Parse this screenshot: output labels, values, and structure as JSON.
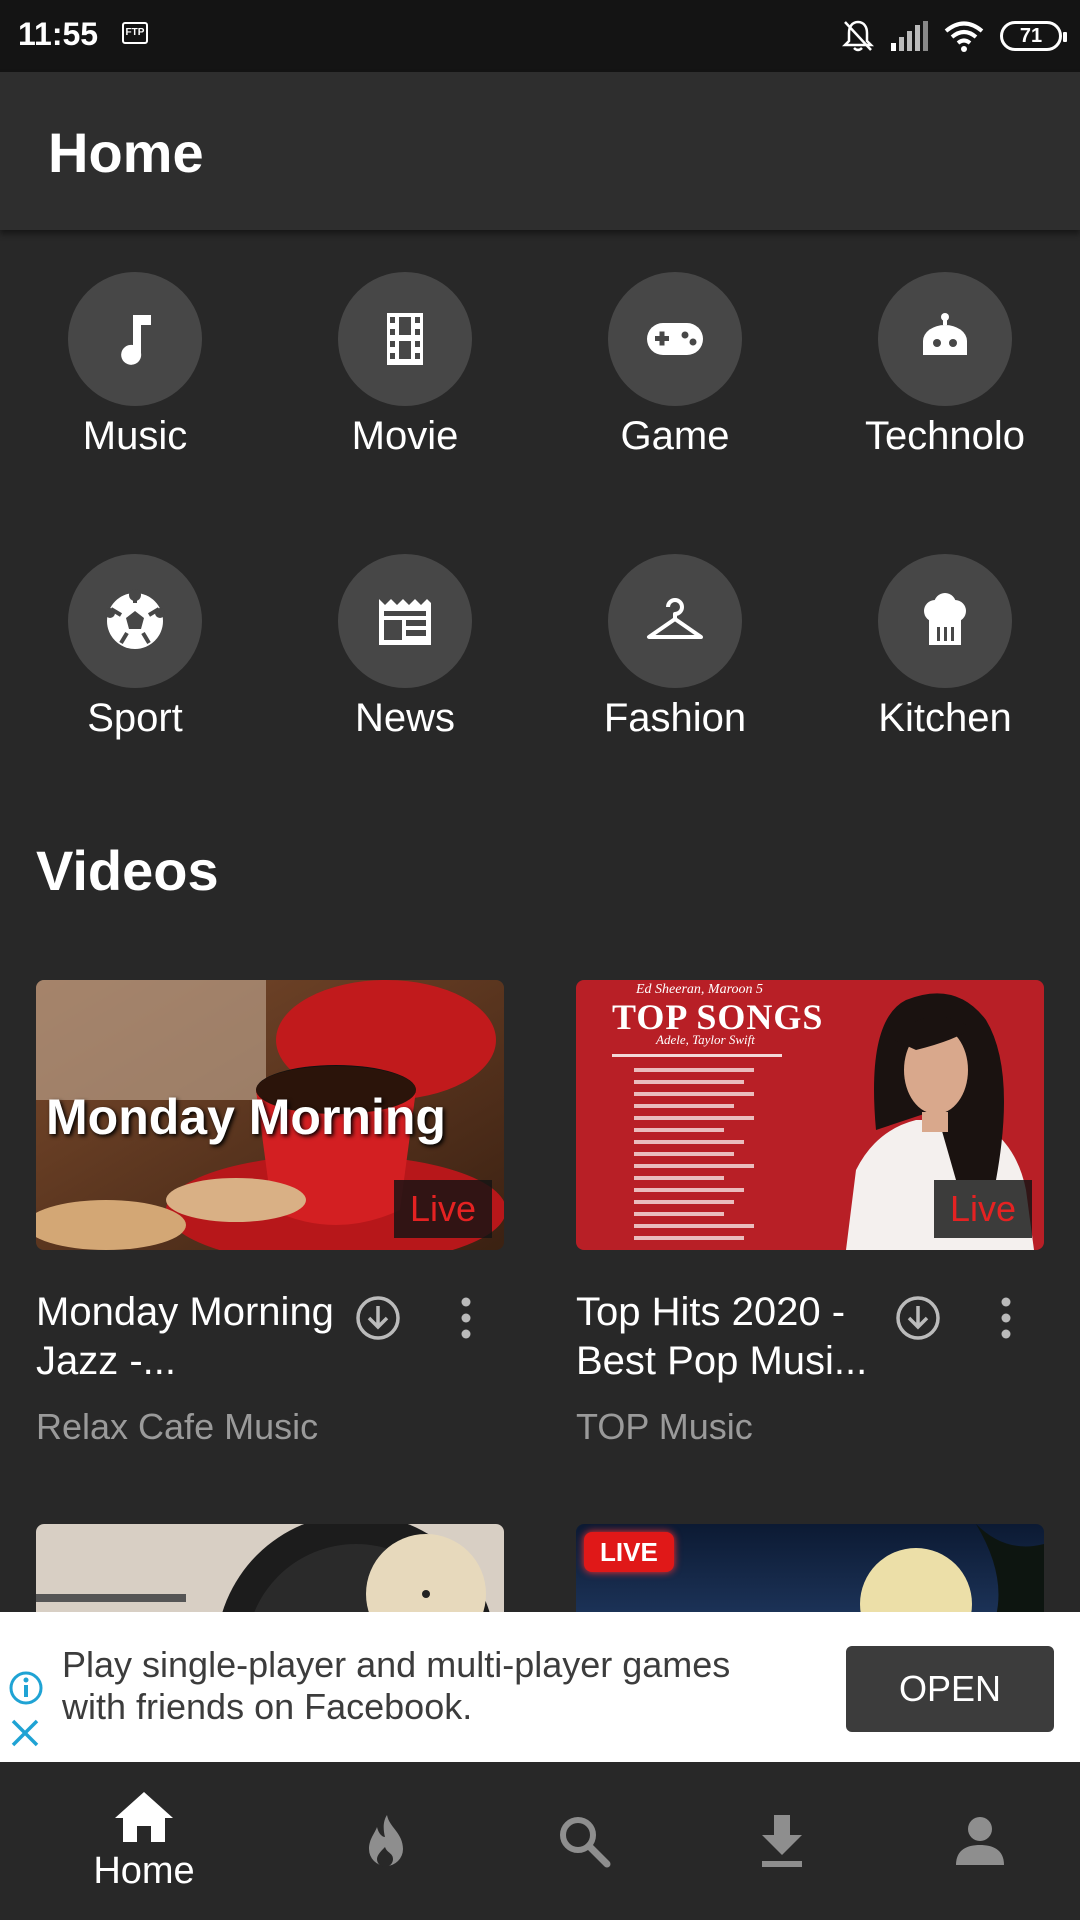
{
  "status_bar": {
    "time": "11:55",
    "ftp_badge": "FTP",
    "battery": "71",
    "icons": [
      "mute-bell-icon",
      "signal-icon",
      "wifi-icon",
      "battery-icon"
    ]
  },
  "app_bar": {
    "title": "Home"
  },
  "categories": [
    {
      "label": "Music",
      "icon": "music-note-icon"
    },
    {
      "label": "Movie",
      "icon": "film-icon"
    },
    {
      "label": "Game",
      "icon": "gamepad-icon"
    },
    {
      "label": "Technolo",
      "icon": "robot-icon"
    },
    {
      "label": "Sport",
      "icon": "soccer-ball-icon"
    },
    {
      "label": "News",
      "icon": "newspaper-icon"
    },
    {
      "label": "Fashion",
      "icon": "hanger-icon"
    },
    {
      "label": "Kitchen",
      "icon": "chef-hat-icon"
    }
  ],
  "videos_section": {
    "title": "Videos"
  },
  "videos": [
    {
      "thumb_text": "Monday Morning",
      "live_badge": "Live",
      "title": "Monday Morning Jazz -...",
      "channel": "Relax Cafe Music"
    },
    {
      "thumb_text": "TOP SONGS",
      "thumb_subtext": "Ed Sheeran, Maroon 5",
      "thumb_subtext2": "Adele, Taylor Swift",
      "live_badge": "Live",
      "title": "Top Hits 2020 - Best Pop Musi...",
      "channel": "TOP Music"
    }
  ],
  "partial_videos": [
    {
      "badge": ""
    },
    {
      "badge": "LIVE"
    }
  ],
  "ad": {
    "text": "Play single-player and multi-player games with friends on Facebook.",
    "button": "OPEN"
  },
  "bottom_nav": [
    {
      "label": "Home",
      "icon": "home-icon",
      "active": true
    },
    {
      "label": "",
      "icon": "trending-fire-icon"
    },
    {
      "label": "",
      "icon": "search-icon"
    },
    {
      "label": "",
      "icon": "download-icon"
    },
    {
      "label": "",
      "icon": "account-icon"
    }
  ],
  "colors": {
    "background": "#282828",
    "app_bar": "#2e2e2e",
    "status_bar": "#141414",
    "live_red": "#e52222",
    "circle": "#474747"
  }
}
